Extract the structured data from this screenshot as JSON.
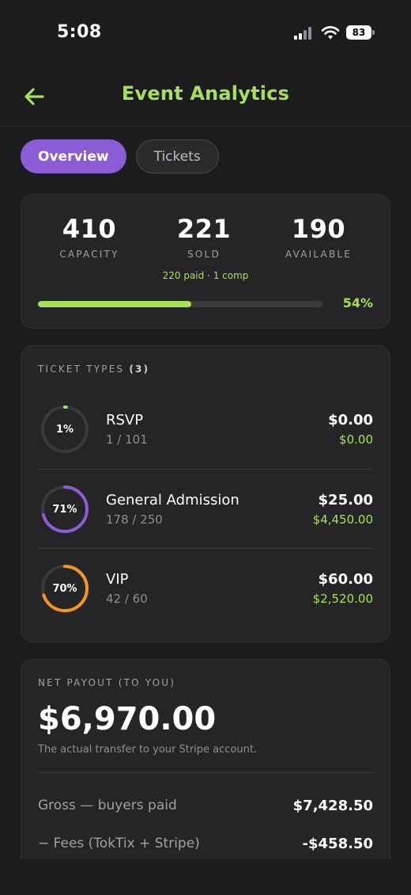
{
  "status_bar": {
    "time": "5:08",
    "battery": "83"
  },
  "header": {
    "title": "Event Analytics",
    "back_icon": "arrow-left-icon"
  },
  "tabs": [
    {
      "label": "Overview",
      "active": true
    },
    {
      "label": "Tickets",
      "active": false
    }
  ],
  "stats": {
    "capacity": {
      "value": "410",
      "label": "CAPACITY"
    },
    "sold": {
      "value": "221",
      "label": "SOLD"
    },
    "available": {
      "value": "190",
      "label": "AVAILABLE"
    },
    "sub": "220 paid · 1 comp",
    "progress": 0.54,
    "progress_label": "54%"
  },
  "ticket_types": {
    "label": "TICKET TYPES",
    "count": "(3)",
    "items": [
      {
        "pct_label": "1%",
        "pct": 0.01,
        "ring_color": "#a7e05a",
        "name": "RSVP",
        "count": "1 / 101",
        "price": "$0.00",
        "revenue": "$0.00"
      },
      {
        "pct_label": "71%",
        "pct": 0.71,
        "ring_color": "#8b5cd6",
        "name": "General Admission",
        "count": "178 / 250",
        "price": "$25.00",
        "revenue": "$4,450.00"
      },
      {
        "pct_label": "70%",
        "pct": 0.7,
        "ring_color": "#f5941e",
        "name": "VIP",
        "count": "42 / 60",
        "price": "$60.00",
        "revenue": "$2,520.00"
      }
    ]
  },
  "payout": {
    "label": "NET PAYOUT (TO YOU)",
    "amount": "$6,970.00",
    "note": "The actual transfer to your Stripe account.",
    "lines": [
      {
        "label": "Gross — buyers paid",
        "value": "$7,428.50"
      },
      {
        "label": "− Fees (TokTix + Stripe)",
        "value": "-$458.50"
      }
    ]
  },
  "colors": {
    "accent": "#a7e05a",
    "purple": "#8b5cd6",
    "orange": "#f5941e",
    "background": "#1c1c1e",
    "card": "#252527"
  }
}
